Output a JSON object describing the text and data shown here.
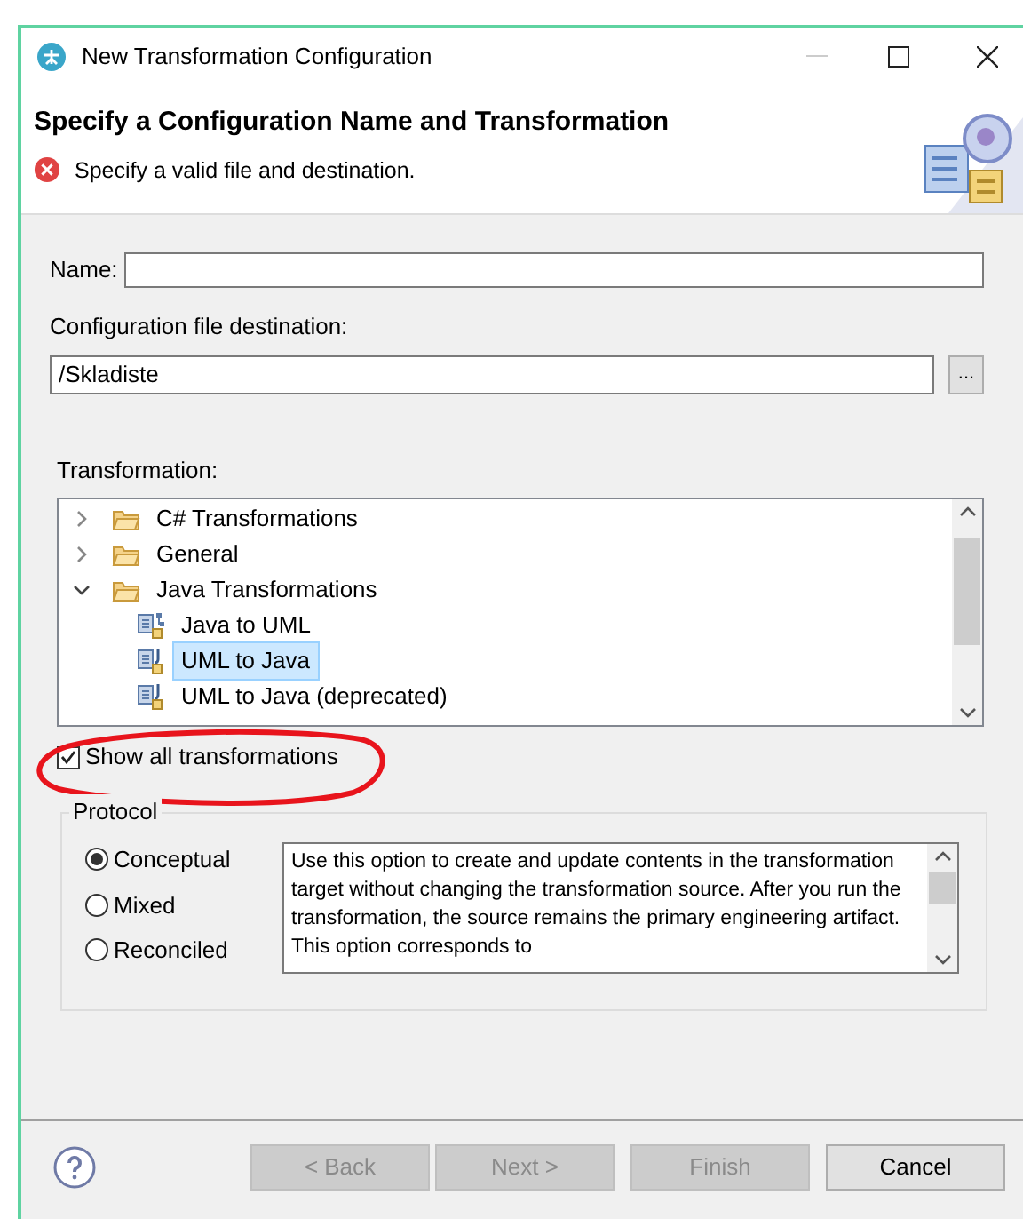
{
  "window": {
    "title": "New Transformation Configuration"
  },
  "header": {
    "title": "Specify a Configuration Name and Transformation",
    "message": "Specify a valid file and destination."
  },
  "name_field": {
    "label": "Name:"
  },
  "destination": {
    "label": "Configuration file destination:",
    "value": "/Skladiste",
    "browse": "..."
  },
  "transformation": {
    "label": "Transformation:",
    "tree": [
      {
        "label": "C# Transformations",
        "kind": "folder",
        "expanded": false,
        "selected": false
      },
      {
        "label": "General",
        "kind": "folder",
        "expanded": false,
        "selected": false
      },
      {
        "label": "Java Transformations",
        "kind": "folder",
        "expanded": true,
        "selected": false,
        "children": [
          {
            "label": "Java to UML",
            "kind": "model",
            "selected": false
          },
          {
            "label": "UML to Java",
            "kind": "transform",
            "selected": true
          },
          {
            "label": "UML to Java (deprecated)",
            "kind": "transform",
            "selected": false
          }
        ]
      }
    ]
  },
  "show_all": {
    "label": "Show all transformations",
    "checked": true
  },
  "protocol": {
    "label": "Protocol",
    "options": [
      {
        "label": "Conceptual",
        "selected": true
      },
      {
        "label": "Mixed",
        "selected": false
      },
      {
        "label": "Reconciled",
        "selected": false
      }
    ],
    "description": "Use this option to create and update contents in the transformation target without changing the transformation source. After you run the transformation, the source remains the primary engineering artifact. This option corresponds to"
  },
  "buttons": [
    {
      "label": "< Back",
      "disabled": true
    },
    {
      "label": "Next >",
      "disabled": true
    },
    {
      "label": "Finish",
      "disabled": true
    },
    {
      "label": "Cancel",
      "disabled": false
    }
  ]
}
